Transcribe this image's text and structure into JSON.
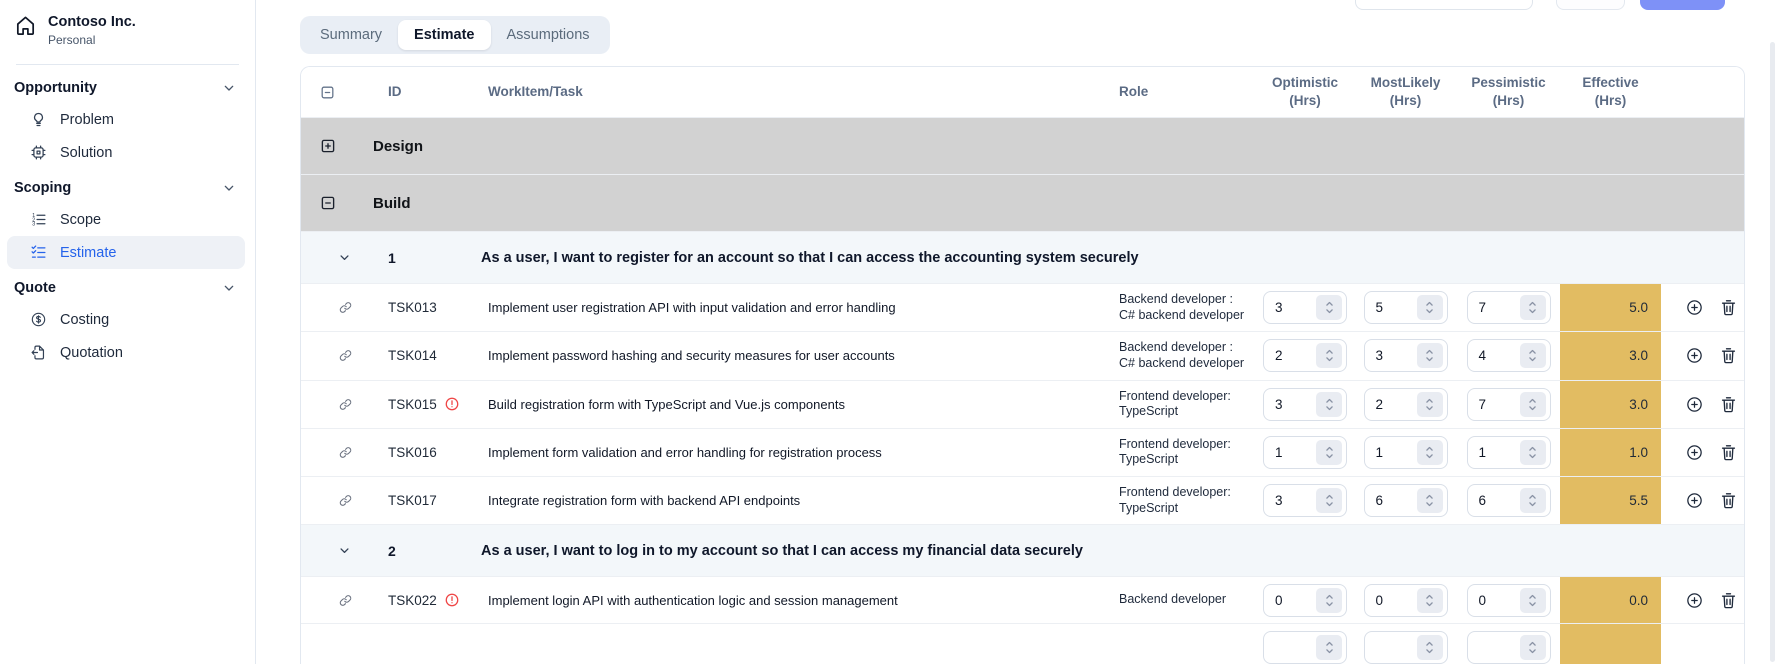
{
  "sidebar": {
    "org_name": "Contoso Inc.",
    "org_subtitle": "Personal",
    "sections": [
      {
        "label": "Opportunity",
        "items": [
          {
            "icon": "lightbulb",
            "label": "Problem",
            "active": false
          },
          {
            "icon": "cpu",
            "label": "Solution",
            "active": false
          }
        ]
      },
      {
        "label": "Scoping",
        "items": [
          {
            "icon": "ordered-list",
            "label": "Scope",
            "active": false
          },
          {
            "icon": "checklist",
            "label": "Estimate",
            "active": true
          }
        ]
      },
      {
        "label": "Quote",
        "items": [
          {
            "icon": "dollar-circle",
            "label": "Costing",
            "active": false
          },
          {
            "icon": "file-export",
            "label": "Quotation",
            "active": false
          }
        ]
      }
    ]
  },
  "tabs": [
    {
      "label": "Summary",
      "active": false
    },
    {
      "label": "Estimate",
      "active": true
    },
    {
      "label": "Assumptions",
      "active": false
    }
  ],
  "table": {
    "columns": [
      {
        "id": "select",
        "label": "",
        "unit": ""
      },
      {
        "id": "id",
        "label": "ID",
        "unit": ""
      },
      {
        "id": "task",
        "label": "WorkItem/Task",
        "unit": ""
      },
      {
        "id": "role",
        "label": "Role",
        "unit": ""
      },
      {
        "id": "optimistic",
        "label": "Optimistic",
        "unit": "(Hrs)"
      },
      {
        "id": "mostlikely",
        "label": "MostLikely",
        "unit": "(Hrs)"
      },
      {
        "id": "pessimistic",
        "label": "Pessimistic",
        "unit": "(Hrs)"
      },
      {
        "id": "effective",
        "label": "Effective",
        "unit": "(Hrs)"
      },
      {
        "id": "actions",
        "label": "",
        "unit": ""
      }
    ],
    "rows": [
      {
        "type": "group",
        "label": "Design",
        "state": "collapsed"
      },
      {
        "type": "group",
        "label": "Build",
        "state": "expanded"
      },
      {
        "type": "story",
        "number": "1",
        "title": "As a user, I want to register for an account so that I can access the accounting system securely"
      },
      {
        "type": "task",
        "id": "TSK013",
        "warning": false,
        "task": "Implement user registration API with input validation and error handling",
        "role": "Backend developer : C# backend developer",
        "optimistic": "3",
        "mostLikely": "5",
        "pessimistic": "7",
        "effective": "5.0"
      },
      {
        "type": "task",
        "id": "TSK014",
        "warning": false,
        "task": "Implement password hashing and security measures for user accounts",
        "role": "Backend developer : C# backend developer",
        "optimistic": "2",
        "mostLikely": "3",
        "pessimistic": "4",
        "effective": "3.0"
      },
      {
        "type": "task",
        "id": "TSK015",
        "warning": true,
        "task": "Build registration form with TypeScript and Vue.js components",
        "role": "Frontend developer: TypeScript",
        "optimistic": "3",
        "mostLikely": "2",
        "pessimistic": "7",
        "effective": "3.0"
      },
      {
        "type": "task",
        "id": "TSK016",
        "warning": false,
        "task": "Implement form validation and error handling for registration process",
        "role": "Frontend developer: TypeScript",
        "optimistic": "1",
        "mostLikely": "1",
        "pessimistic": "1",
        "effective": "1.0"
      },
      {
        "type": "task",
        "id": "TSK017",
        "warning": false,
        "task": "Integrate registration form with backend API endpoints",
        "role": "Frontend developer: TypeScript",
        "optimistic": "3",
        "mostLikely": "6",
        "pessimistic": "6",
        "effective": "5.5"
      },
      {
        "type": "story",
        "number": "2",
        "title": "As a user, I want to log in to my account so that I can access my financial data securely"
      },
      {
        "type": "task",
        "id": "TSK022",
        "warning": true,
        "task": "Implement login API with authentication logic and session management",
        "role": "Backend developer",
        "optimistic": "0",
        "mostLikely": "0",
        "pessimistic": "0",
        "effective": "0.0"
      },
      {
        "type": "task",
        "partial": true,
        "id": "",
        "warning": false,
        "task": "",
        "role": "",
        "optimistic": "",
        "mostLikely": "",
        "pessimistic": "",
        "effective": ""
      }
    ]
  },
  "colors": {
    "accent_blue": "#2563eb",
    "effective_cell": "#e2bc62",
    "warning_red": "#ef4444",
    "group_row_bg": "#d2d2d2",
    "story_row_bg": "#f3f7fa",
    "primary_button": "#7e91f7"
  }
}
